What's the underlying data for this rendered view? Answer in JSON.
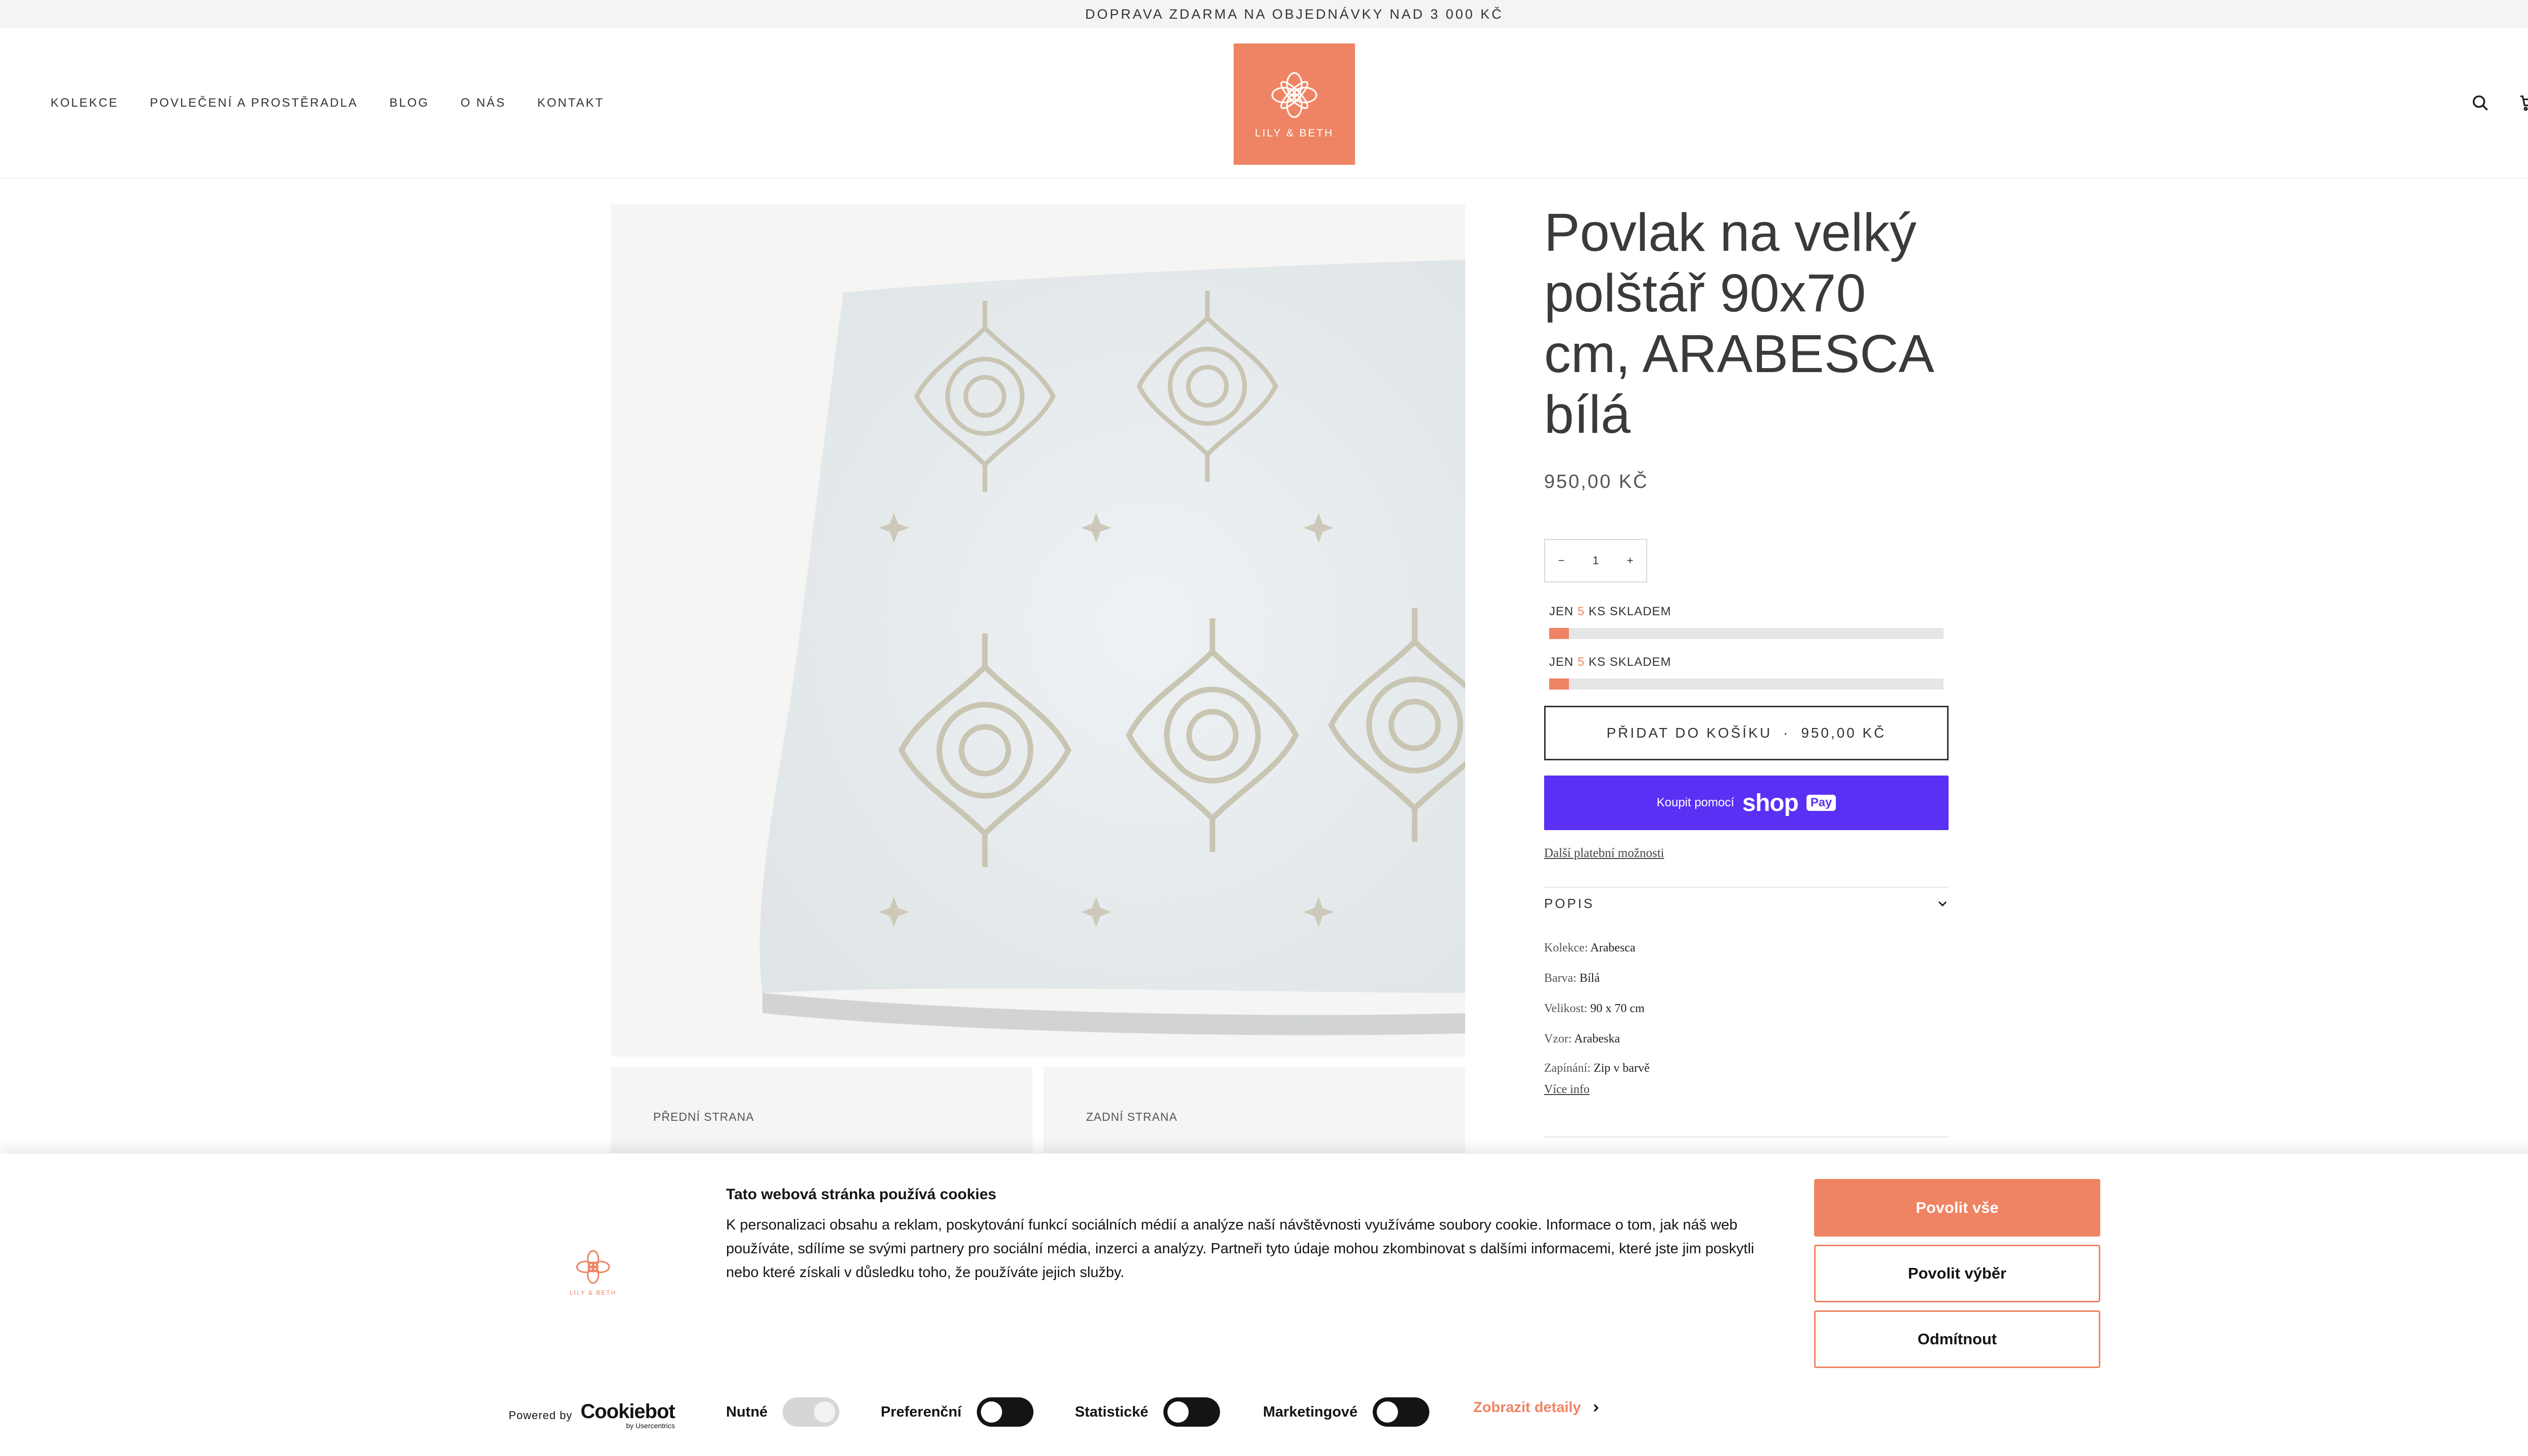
{
  "announcement": "DOPRAVA ZDARMA NA OBJEDNÁVKY NAD 3 000 KČ",
  "nav": [
    {
      "label": "KOLEKCE"
    },
    {
      "label": "POVLEČENÍ A PROSTĚRADLA"
    },
    {
      "label": "BLOG"
    },
    {
      "label": "O NÁS"
    },
    {
      "label": "KONTAKT"
    }
  ],
  "brand": {
    "name": "LILY & BETH",
    "color": "#ee8463"
  },
  "header_icons": {
    "search": "search-icon",
    "cart": "cart-icon"
  },
  "product": {
    "title": "Povlak na velký polštář 90x70 cm, ARABESCA bílá",
    "price": "950,00 KČ",
    "quantity": "1",
    "qty_minus": "−",
    "qty_plus": "+",
    "stock": [
      {
        "prefix": "JEN",
        "count": "5",
        "suffix": "KS SKLADEM",
        "level": 0.05
      },
      {
        "prefix": "JEN",
        "count": "5",
        "suffix": "KS SKLADEM",
        "level": 0.05
      }
    ],
    "add_to_cart": "PŘIDAT DO KOŠÍKU",
    "add_to_cart_sep": "·",
    "add_to_cart_price": "950,00 KČ",
    "shop_pay_prefix": "Koupit pomocí",
    "shop_pay_brand": "shop",
    "shop_pay_badge": "Pay",
    "more_payment": "Další platební možnosti",
    "accordion_label": "POPIS",
    "specs": [
      {
        "key": "Kolekce:",
        "value": "Arabesca"
      },
      {
        "key": "Barva:",
        "value": "Bílá"
      },
      {
        "key": "Velikost:",
        "value": "90 x 70 cm"
      },
      {
        "key": "Vzor:",
        "value": "Arabeska"
      },
      {
        "key": "Zapínání:",
        "value": "Zip v barvě"
      }
    ],
    "more_info": "Více info",
    "thumbnails": [
      {
        "label": "PŘEDNÍ STRANA"
      },
      {
        "label": "ZADNÍ STRANA"
      }
    ]
  },
  "cookie": {
    "title": "Tato webová stránka používá cookies",
    "text": "K personalizaci obsahu a reklam, poskytování funkcí sociálních médií a analýze naší návštěvnosti využíváme soubory cookie. Informace o tom, jak náš web používáte, sdílíme se svými partnery pro sociální média, inzerci a analýzy. Partneři tyto údaje mohou zkombinovat s dalšími informacemi, které jste jim poskytli nebo které získali v důsledku toho, že používáte jejich služby.",
    "allow_all": "Povolit vše",
    "allow_selection": "Povolit výběr",
    "deny": "Odmítnout",
    "powered_by": "Powered by",
    "cookiebot": "Cookiebot",
    "by_usercentrics": "by Usercentrics",
    "toggles": [
      {
        "label": "Nutné",
        "state": "disabled"
      },
      {
        "label": "Preferenční",
        "state": "off"
      },
      {
        "label": "Statistické",
        "state": "off"
      },
      {
        "label": "Marketingové",
        "state": "off"
      }
    ],
    "details": "Zobrazit detaily"
  }
}
